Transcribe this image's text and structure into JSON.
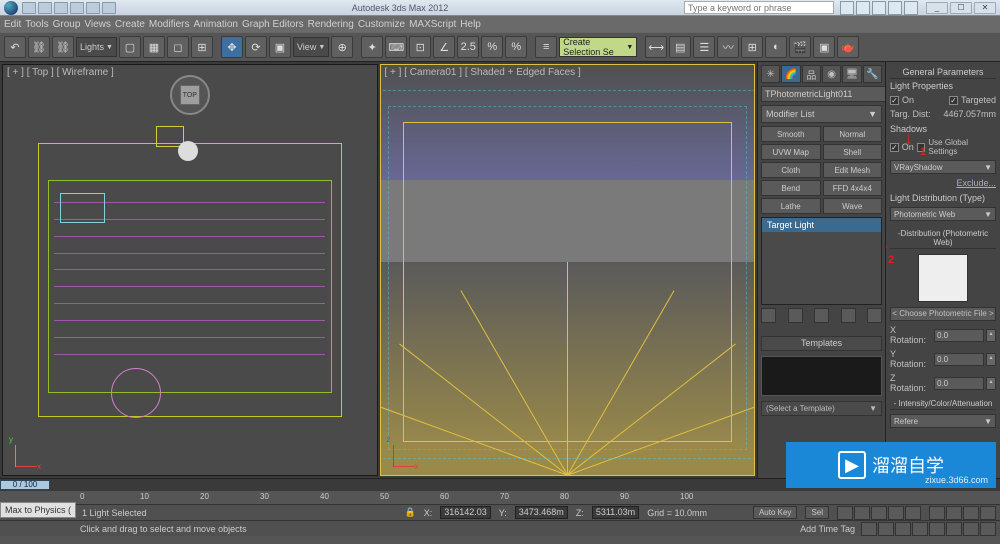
{
  "app_title": "Autodesk 3ds Max 2012",
  "search_placeholder": "Type a keyword or phrase",
  "window_buttons": [
    "_",
    "☐",
    "✕"
  ],
  "menus": [
    "Edit",
    "Tools",
    "Group",
    "Views",
    "Create",
    "Modifiers",
    "Animation",
    "Graph Editors",
    "Rendering",
    "Customize",
    "MAXScript",
    "Help"
  ],
  "toolbar": {
    "lights_dropdown": "Lights",
    "view_dropdown": "View",
    "angle_value": "2.5",
    "selset": "Create Selection Se"
  },
  "viewports": {
    "top_label": "[ + ] [ Top ] [ Wireframe ]",
    "cam_label": "[ + ] [ Camera01 ] [ Shaded + Edged Faces ]",
    "cube_face": "TOP"
  },
  "command_panel": {
    "object_name": "TPhotometricLight011",
    "modifier_list": "Modifier List",
    "mod_buttons": [
      "Smooth",
      "Normal",
      "UVW Map",
      "Shell",
      "Cloth",
      "Edit Mesh",
      "Bend",
      "FFD 4x4x4",
      "Lathe",
      "Wave"
    ],
    "stack_item": "Target Light",
    "templates_header": "Templates",
    "template_select": "(Select a Template)"
  },
  "properties": {
    "gen_params": "General Parameters",
    "light_props": "Light Properties",
    "on": "On",
    "targeted": "Targeted",
    "targ_dist_label": "Targ. Dist:",
    "targ_dist_value": "4467.057mm",
    "shadows": "Shadows",
    "use_global": "Use Global Settings",
    "shadow_type": "VRayShadow",
    "exclude": "Exclude...",
    "dist_type_label": "Light Distribution (Type)",
    "dist_type": "Photometric Web",
    "dist_header": "-Distribution (Photometric Web)",
    "choose_file": "< Choose Photometric File >",
    "xrot": "X Rotation:",
    "xrot_v": "0.0",
    "yrot": "Y Rotation:",
    "yrot_v": "0.0",
    "zrot": "Z Rotation:",
    "zrot_v": "0.0",
    "intensity_header": "- Intensity/Color/Attenuation",
    "reference": "Refere"
  },
  "arrow1": "1",
  "arrow2": "2",
  "timeline": {
    "frame_display": "0 / 100",
    "ticks": [
      "0",
      "10",
      "20",
      "30",
      "40",
      "50",
      "60",
      "70",
      "80",
      "90",
      "100"
    ]
  },
  "status": {
    "selection": "1 Light Selected",
    "hint": "Click and drag to select and move objects",
    "lock_icon": "🔒",
    "x": "X:",
    "x_v": "316142.03",
    "y": "Y:",
    "y_v": "3473.468m",
    "z": "Z:",
    "z_v": "5311.03m",
    "grid": "Grid = 10.0mm",
    "add_tag": "Add Time Tag",
    "auto_key": "Auto Key",
    "set_key_short": "Sel",
    "max_to_phys": "Max to Physics ("
  },
  "watermark": {
    "brand": "溜溜自学",
    "url": "zixue.3d66.com"
  }
}
